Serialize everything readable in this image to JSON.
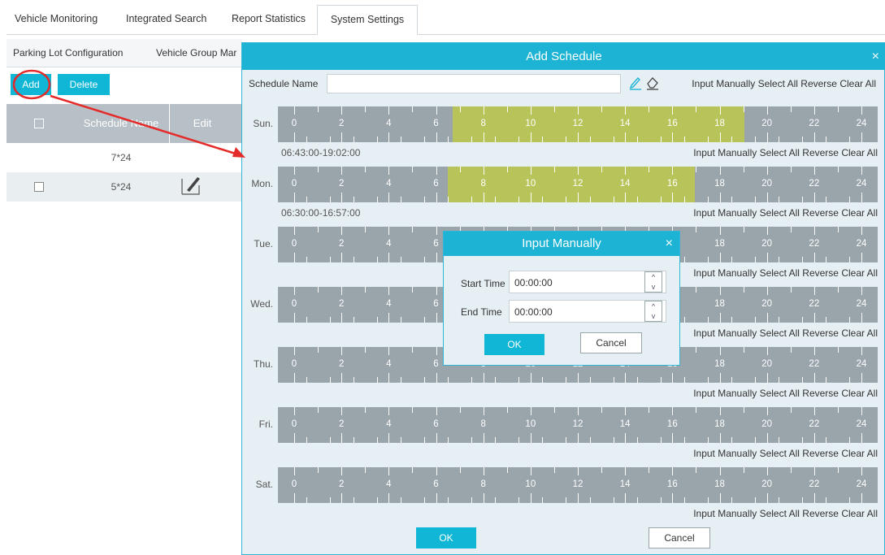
{
  "top_tabs": [
    "Vehicle Monitoring",
    "Integrated Search",
    "Report Statistics",
    "System Settings"
  ],
  "active_tab": "System Settings",
  "sub_nav": [
    "Parking Lot Configuration",
    "Vehicle Group Mar"
  ],
  "left_toolbar": {
    "add_label": "Add",
    "delete_label": "Delete"
  },
  "left_table": {
    "columns": [
      "Schedule Name",
      "Edit"
    ],
    "rows": [
      {
        "name": "7*24",
        "checkbox": false,
        "edit": false
      },
      {
        "name": "5*24",
        "checkbox": true,
        "edit": true
      }
    ]
  },
  "modal": {
    "title": "Add Schedule",
    "close_glyph": "×",
    "schedule_name_label": "Schedule Name",
    "schedule_name_value": "",
    "header_links": [
      "Input Manually",
      "Select All",
      "Reverse",
      "Clear All"
    ],
    "hour_labels": [
      "0",
      "2",
      "4",
      "6",
      "8",
      "10",
      "12",
      "14",
      "16",
      "18",
      "20",
      "22",
      "24"
    ],
    "days": [
      {
        "label": "Sun.",
        "range": "06:43:00-19:02:00",
        "highlight": [
          6.717,
          19.033
        ]
      },
      {
        "label": "Mon.",
        "range": "06:30:00-16:57:00",
        "highlight": [
          6.5,
          16.95
        ]
      },
      {
        "label": "Tue.",
        "range": "",
        "highlight": null
      },
      {
        "label": "Wed.",
        "range": "",
        "highlight": null
      },
      {
        "label": "Thu.",
        "range": "",
        "highlight": null
      },
      {
        "label": "Fri.",
        "range": "",
        "highlight": null
      },
      {
        "label": "Sat.",
        "range": "",
        "highlight": null
      }
    ],
    "day_links": [
      "Input Manually",
      "Select All",
      "Reverse",
      "Clear All"
    ],
    "ok_label": "OK",
    "cancel_label": "Cancel"
  },
  "input_dialog": {
    "title": "Input Manually",
    "close_glyph": "×",
    "start_label": "Start Time",
    "start_value": "00:00:00",
    "end_label": "End Time",
    "end_value": "00:00:00",
    "ok_label": "OK",
    "cancel_label": "Cancel"
  },
  "colors": {
    "accent": "#1cb3d4",
    "highlight": "#b8c35a",
    "bar": "#9aa4ab",
    "annotation": "#e52a2a"
  }
}
